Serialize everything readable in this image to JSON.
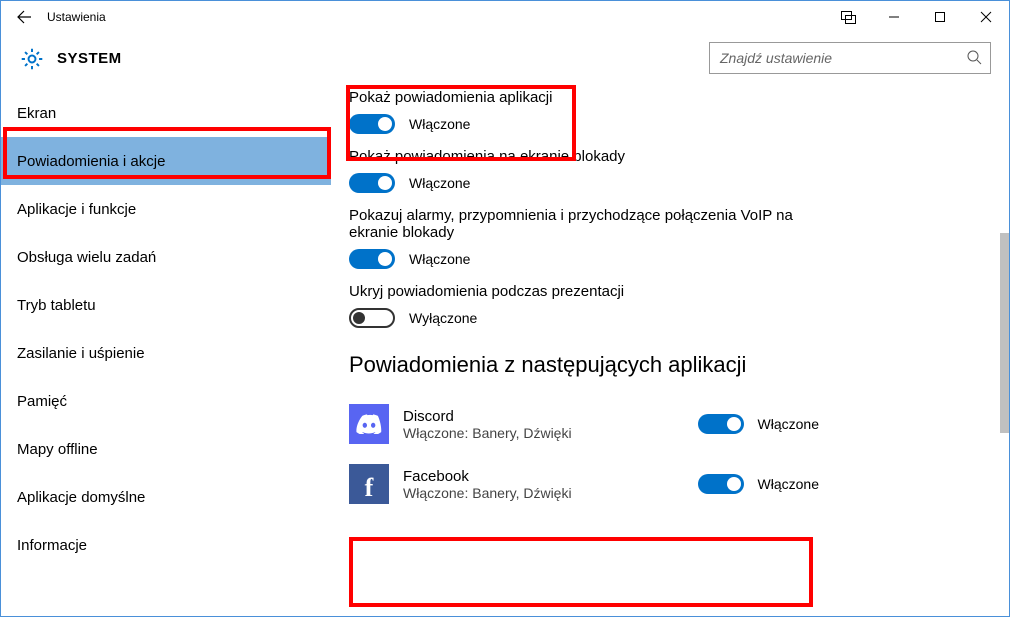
{
  "window": {
    "title": "Ustawienia"
  },
  "header": {
    "system_label": "SYSTEM",
    "search_placeholder": "Znajdź ustawienie"
  },
  "sidebar": {
    "items": [
      {
        "label": "Ekran",
        "selected": false
      },
      {
        "label": "Powiadomienia i akcje",
        "selected": true
      },
      {
        "label": "Aplikacje i funkcje",
        "selected": false
      },
      {
        "label": "Obsługa wielu zadań",
        "selected": false
      },
      {
        "label": "Tryb tabletu",
        "selected": false
      },
      {
        "label": "Zasilanie i uśpienie",
        "selected": false
      },
      {
        "label": "Pamięć",
        "selected": false
      },
      {
        "label": "Mapy offline",
        "selected": false
      },
      {
        "label": "Aplikacje domyślne",
        "selected": false
      },
      {
        "label": "Informacje",
        "selected": false
      }
    ]
  },
  "settings": {
    "s1": {
      "label": "Pokaż powiadomienia aplikacji",
      "state": "Włączone",
      "on": true
    },
    "s2": {
      "label": "Pokaż powiadomienia na ekranie blokady",
      "state": "Włączone",
      "on": true
    },
    "s3": {
      "label": "Pokazuj alarmy, przypomnienia i przychodzące połączenia VoIP na ekranie blokady",
      "state": "Włączone",
      "on": true
    },
    "s4": {
      "label": "Ukryj powiadomienia podczas prezentacji",
      "state": "Wyłączone",
      "on": false
    }
  },
  "apps_section_heading": "Powiadomienia z następujących aplikacji",
  "apps": [
    {
      "name": "Discord",
      "desc": "Włączone: Banery, Dźwięki",
      "state": "Włączone",
      "on": true,
      "icon": "discord"
    },
    {
      "name": "Facebook",
      "desc": "Włączone: Banery, Dźwięki",
      "state": "Włączone",
      "on": true,
      "icon": "facebook"
    }
  ]
}
